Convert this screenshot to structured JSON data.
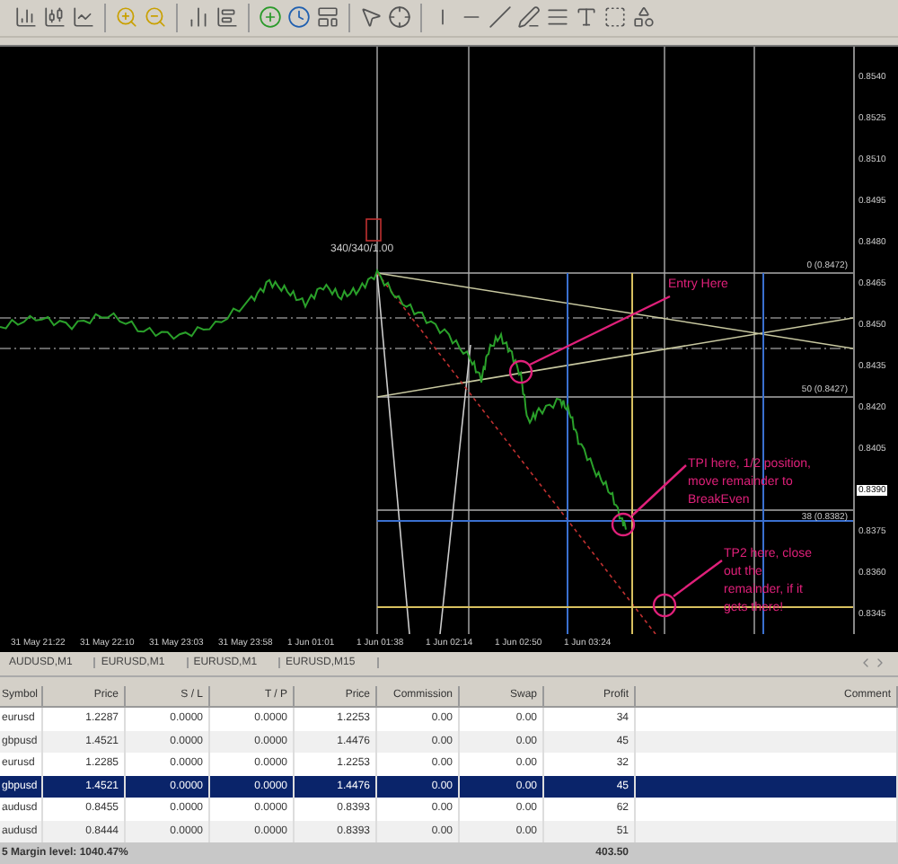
{
  "chart": {
    "order_label": "340/340/1.00",
    "annotations": [
      {
        "lines": [
          "Entry Here"
        ]
      },
      {
        "lines": [
          "TPI here, 1/2 position,",
          "move remainder to",
          "BreakEven"
        ]
      },
      {
        "lines": [
          "TP2 here, close",
          "out the",
          "remainder, if it",
          "gets there!"
        ]
      }
    ],
    "fib_levels": [
      "0 (0.8472)",
      "50 (0.8427)",
      "38 (0.8382)"
    ],
    "price_axis": [
      {
        "label": "0.8540",
        "current": false
      },
      {
        "label": "0.8525",
        "current": false
      },
      {
        "label": "0.8510",
        "current": false
      },
      {
        "label": "0.8495",
        "current": false
      },
      {
        "label": "0.8480",
        "current": false
      },
      {
        "label": "0.8465",
        "current": false
      },
      {
        "label": "0.8450",
        "current": false
      },
      {
        "label": "0.8435",
        "current": false
      },
      {
        "label": "0.8420",
        "current": false
      },
      {
        "label": "0.8405",
        "current": false
      },
      {
        "label": "0.8390",
        "current": true
      },
      {
        "label": "0.8375",
        "current": false
      },
      {
        "label": "0.8360",
        "current": false
      },
      {
        "label": "0.8345",
        "current": false
      }
    ],
    "time_axis": [
      "31 May 21:22",
      "31 May 22:10",
      "31 May 23:03",
      "31 May 23:58",
      "1 Jun 01:01",
      "1 Jun 01:38",
      "1 Jun 02:14",
      "1 Jun 02:50",
      "1 Jun 03:24"
    ]
  },
  "chart_tabs": [
    "AUDUSD,M1",
    "EURUSD,M1",
    "EURUSD,M1",
    "EURUSD,M15"
  ],
  "table": {
    "columns": [
      "Symbol",
      "Price",
      "S / L",
      "T / P",
      "Price",
      "Commission",
      "Swap",
      "Profit",
      "Comment"
    ],
    "rows": [
      {
        "cells": [
          "eurusd",
          "1.2287",
          "0.0000",
          "0.0000",
          "1.2253",
          "0.00",
          "0.00",
          "34",
          ""
        ],
        "selected": false
      },
      {
        "cells": [
          "gbpusd",
          "1.4521",
          "0.0000",
          "0.0000",
          "1.4476",
          "0.00",
          "0.00",
          "45",
          ""
        ],
        "selected": false
      },
      {
        "cells": [
          "eurusd",
          "1.2285",
          "0.0000",
          "0.0000",
          "1.2253",
          "0.00",
          "0.00",
          "32",
          ""
        ],
        "selected": false
      },
      {
        "cells": [
          "gbpusd",
          "1.4521",
          "0.0000",
          "0.0000",
          "1.4476",
          "0.00",
          "0.00",
          "45",
          ""
        ],
        "selected": true
      },
      {
        "cells": [
          "audusd",
          "0.8455",
          "0.0000",
          "0.0000",
          "0.8393",
          "0.00",
          "0.00",
          "62",
          ""
        ],
        "selected": false
      },
      {
        "cells": [
          "audusd",
          "0.8444",
          "0.0000",
          "0.0000",
          "0.8393",
          "0.00",
          "0.00",
          "51",
          ""
        ],
        "selected": false
      }
    ],
    "total": {
      "label": "5 Margin level: 1040.47%",
      "profit": "403.50"
    }
  }
}
